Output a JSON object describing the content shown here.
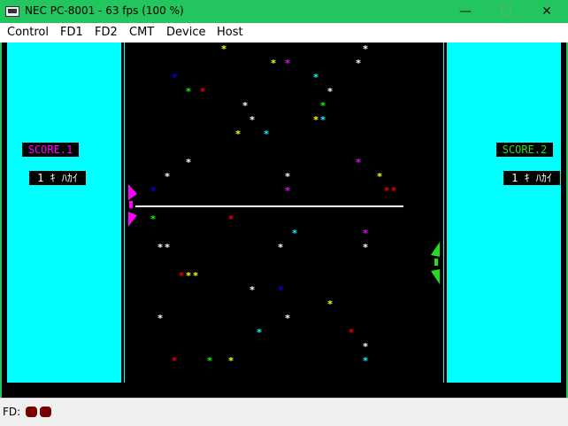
{
  "window": {
    "title": "NEC PC-8001 - 63 fps (100 %)",
    "minimize_glyph": "—",
    "maximize_glyph": "☐",
    "close_glyph": "✕"
  },
  "menu": [
    "Control",
    "FD1",
    "FD2",
    "CMT",
    "Device",
    "Host"
  ],
  "game": {
    "score1_label": "SCORE.1",
    "score1_value": "1 ｷ ﾊｶｲ",
    "score2_label": "SCORE.2",
    "score2_value": "1 ｷ ﾊｶｲ",
    "colors": {
      "panel": "#00ffff",
      "player1": "#ff00ff",
      "player2": "#22dd22",
      "line": "#ffffff"
    },
    "star_glyph": "*",
    "stars": [
      {
        "c": "#ffff00"
      },
      {
        "c": "#ffffff"
      },
      {
        "c": "#ffff00"
      },
      {
        "c": "#ff00ff"
      },
      {
        "c": "#ffffff"
      },
      {
        "c": "#0000ff"
      },
      {
        "c": "#00ffff"
      },
      {
        "c": "#00ff00"
      },
      {
        "c": "#ff0000"
      },
      {
        "c": "#ffffff"
      },
      {
        "c": "#ffffff"
      },
      {
        "c": "#00ff00"
      },
      {
        "c": "#ffffff"
      },
      {
        "c": "#ffff00"
      },
      {
        "c": "#00ffff"
      },
      {
        "c": "#ffff00"
      },
      {
        "c": "#00ffff"
      },
      {
        "c": "#ffffff"
      },
      {
        "c": "#ff00ff"
      },
      {
        "c": "#ffffff"
      },
      {
        "c": "#ffffff"
      },
      {
        "c": "#ffff00"
      },
      {
        "c": "#0000ff"
      },
      {
        "c": "#ff00ff"
      },
      {
        "c": "#ff0000"
      },
      {
        "c": "#ff0000"
      },
      {
        "c": "#00ff00"
      },
      {
        "c": "#ff0000"
      },
      {
        "c": "#00ffff"
      },
      {
        "c": "#ff00ff"
      },
      {
        "c": "#ffffff"
      },
      {
        "c": "#ffffff"
      },
      {
        "c": "#ffffff"
      },
      {
        "c": "#ffffff"
      },
      {
        "c": "#ff0000"
      },
      {
        "c": "#ffff00"
      },
      {
        "c": "#ffff00"
      },
      {
        "c": "#ffffff"
      },
      {
        "c": "#0000ff"
      },
      {
        "c": "#ffff00"
      },
      {
        "c": "#ffffff"
      },
      {
        "c": "#ffffff"
      },
      {
        "c": "#00ffff"
      },
      {
        "c": "#ff0000"
      },
      {
        "c": "#ffffff"
      },
      {
        "c": "#ff0000"
      },
      {
        "c": "#00ff00"
      },
      {
        "c": "#ffff00"
      },
      {
        "c": "#00ffff"
      }
    ]
  },
  "status": {
    "fd_label": "FD:",
    "led_color": "#7a0000"
  }
}
